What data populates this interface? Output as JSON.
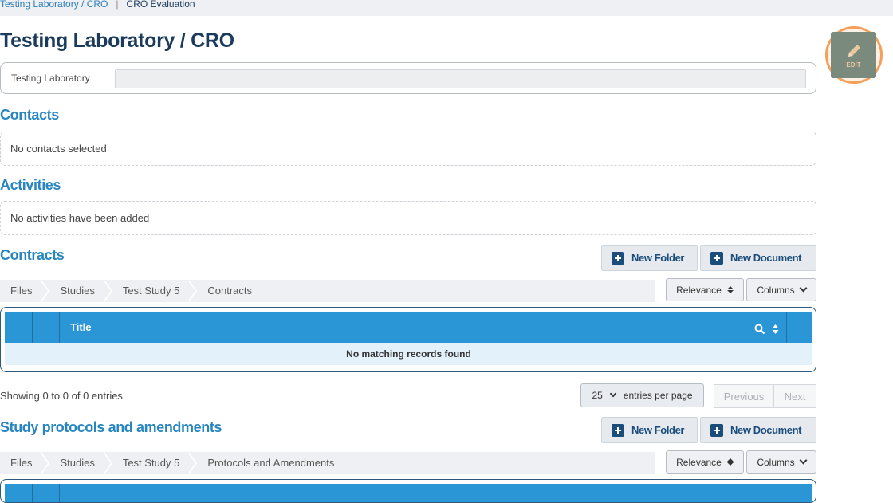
{
  "breadcrumb": {
    "link": "Testing Laboratory / CRO",
    "current": "CRO Evaluation"
  },
  "page_title": "Testing Laboratory / CRO",
  "edit_button": {
    "label": "EDIT",
    "icon": "pencil-icon"
  },
  "lab_field": {
    "label": "Testing Laboratory",
    "value": ""
  },
  "contacts": {
    "heading": "Contacts",
    "empty_text": "No contacts selected"
  },
  "activities": {
    "heading": "Activities",
    "empty_text": "No activities have been added"
  },
  "contracts": {
    "heading": "Contracts",
    "new_folder": "New Folder",
    "new_document": "New Document",
    "path": [
      "Files",
      "Studies",
      "Test Study 5",
      "Contracts"
    ],
    "sort_label": "Relevance",
    "columns_label": "Columns",
    "table": {
      "column_title": "Title",
      "empty_text": "No matching records found"
    },
    "info": "Showing 0 to 0 of 0 entries",
    "page_size": "25",
    "page_size_label": "entries per page",
    "previous": "Previous",
    "next": "Next"
  },
  "protocols": {
    "heading": "Study protocols and amendments",
    "new_folder": "New Folder",
    "new_document": "New Document",
    "path": [
      "Files",
      "Studies",
      "Test Study 5",
      "Protocols and Amendments"
    ],
    "sort_label": "Relevance",
    "columns_label": "Columns"
  },
  "colors": {
    "accent": "#2b96d6",
    "heading": "#2786c0",
    "title": "#1a3b5c",
    "highlight": "#f4a05a"
  }
}
